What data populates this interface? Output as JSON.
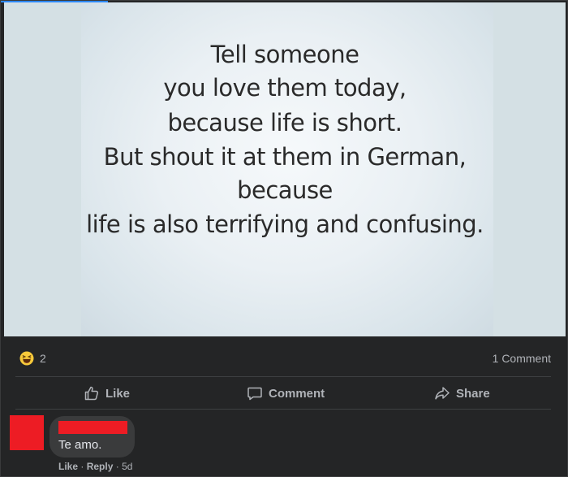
{
  "post": {
    "meme_lines": [
      "Tell someone",
      "you love them today,",
      "because life is short.",
      "But shout it at them in German,",
      "because",
      "life is also terrifying and confusing."
    ],
    "reaction_icon": "haha-emoji-icon",
    "reaction_count": "2",
    "comment_count_label": "1 Comment"
  },
  "actions": {
    "like_label": "Like",
    "comment_label": "Comment",
    "share_label": "Share",
    "like_icon": "thumbs-up-icon",
    "comment_icon": "speech-bubble-icon",
    "share_icon": "share-arrow-icon"
  },
  "comment": {
    "text": "Te amo.",
    "like_label": "Like",
    "separator": "·",
    "reply_label": "Reply",
    "time": "5d",
    "redaction_color": "#ed1c24"
  },
  "colors": {
    "background": "#242526",
    "bubble": "#3a3b3c",
    "muted_text": "#b0b3b8",
    "primary_text": "#e4e6eb",
    "accent_blue": "#2d88ff"
  }
}
